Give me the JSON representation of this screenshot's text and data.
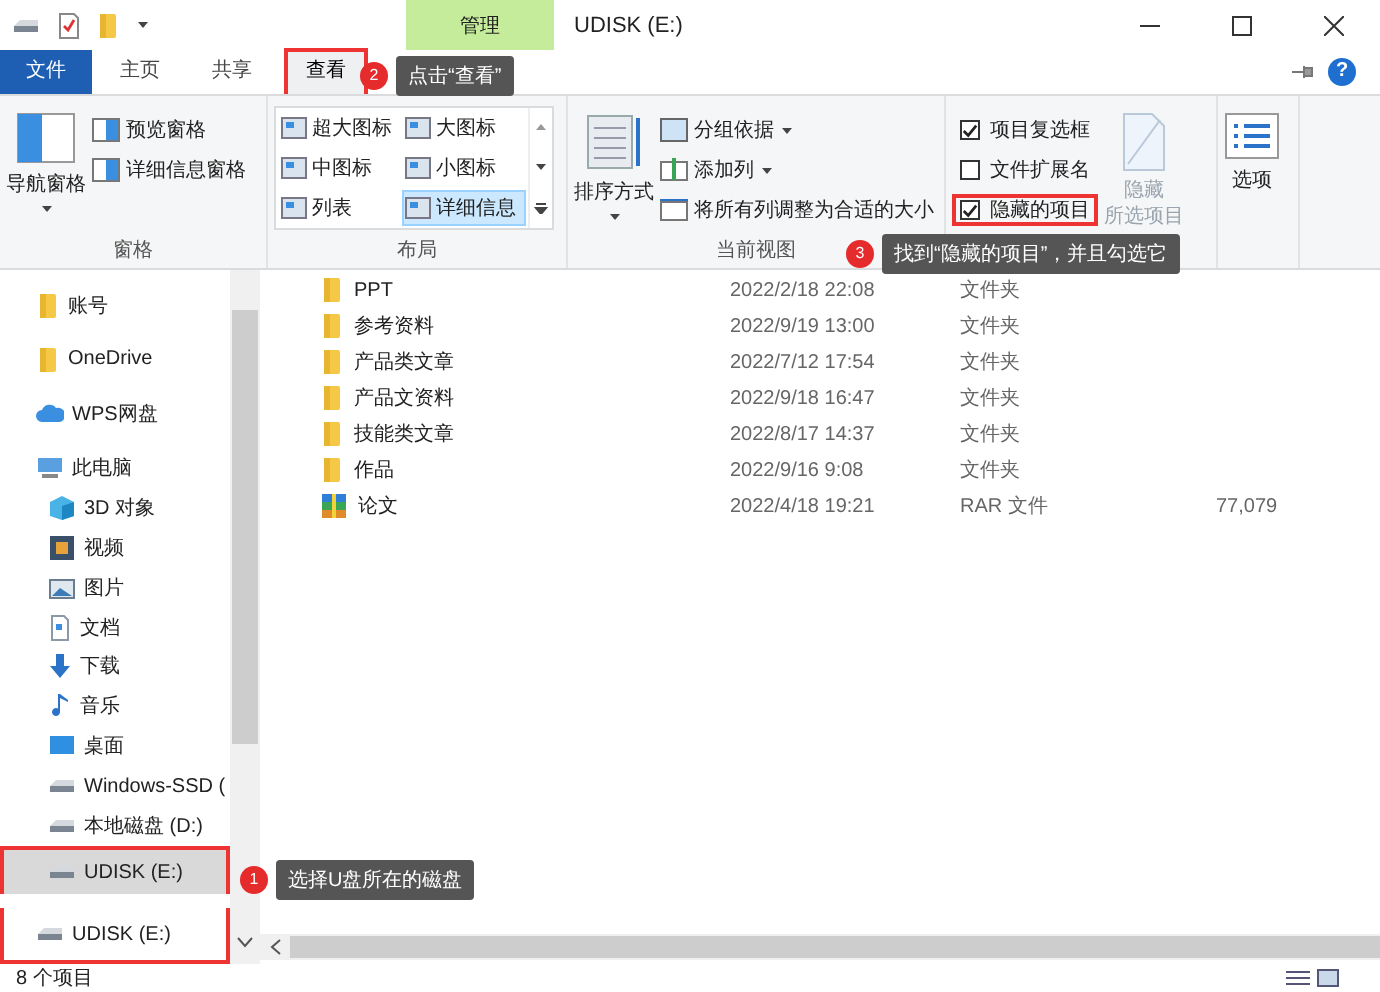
{
  "title_bar": {
    "context_tab": "管理",
    "title": "UDISK (E:)"
  },
  "ribbon_tabs": [
    {
      "label": "文件",
      "kind": "file",
      "selected": false,
      "highlighted": false
    },
    {
      "label": "主页",
      "kind": "tab",
      "selected": false,
      "highlighted": false
    },
    {
      "label": "共享",
      "kind": "tab",
      "selected": false,
      "highlighted": false
    },
    {
      "label": "查看",
      "kind": "tab",
      "selected": true,
      "highlighted": true
    }
  ],
  "help": "?",
  "ribbon": {
    "panes": {
      "label": "窗格",
      "large": "导航窗格",
      "items": [
        "预览窗格",
        "详细信息窗格"
      ]
    },
    "layout": {
      "label": "布局",
      "items": [
        {
          "label": "超大图标",
          "selected": false
        },
        {
          "label": "大图标",
          "selected": false
        },
        {
          "label": "中图标",
          "selected": false
        },
        {
          "label": "小图标",
          "selected": false
        },
        {
          "label": "列表",
          "selected": false
        },
        {
          "label": "详细信息",
          "selected": true
        }
      ]
    },
    "current_view": {
      "label": "当前视图",
      "large": "排序方式",
      "items": [
        {
          "label": "分组依据",
          "dropdown": true
        },
        {
          "label": "添加列",
          "dropdown": true
        },
        {
          "label": "将所有列调整为合适的大小",
          "dropdown": false
        }
      ]
    },
    "show_hide": {
      "checkboxes": [
        {
          "label": "项目复选框",
          "checked": true,
          "highlighted": false
        },
        {
          "label": "文件扩展名",
          "checked": false,
          "highlighted": false
        },
        {
          "label": "隐藏的项目",
          "checked": true,
          "highlighted": true
        }
      ],
      "button": {
        "lines": [
          "隐藏",
          "所选项目"
        ],
        "disabled": true
      }
    },
    "options": {
      "label": "选项"
    }
  },
  "nav": [
    {
      "label": "账号",
      "kind": "folder",
      "selected": false,
      "highlighted": false
    },
    {
      "label": "OneDrive",
      "kind": "folder",
      "selected": false,
      "highlighted": false
    },
    {
      "label": "WPS网盘",
      "kind": "cloud",
      "selected": false,
      "highlighted": false
    },
    {
      "label": "此电脑",
      "kind": "pc",
      "selected": false,
      "highlighted": false,
      "children": [
        {
          "label": "3D 对象",
          "kind": "cube",
          "selected": false,
          "highlighted": false
        },
        {
          "label": "视频",
          "kind": "video",
          "selected": false,
          "highlighted": false
        },
        {
          "label": "图片",
          "kind": "picture",
          "selected": false,
          "highlighted": false
        },
        {
          "label": "文档",
          "kind": "document",
          "selected": false,
          "highlighted": false
        },
        {
          "label": "下载",
          "kind": "download",
          "selected": false,
          "highlighted": false
        },
        {
          "label": "音乐",
          "kind": "music",
          "selected": false,
          "highlighted": false
        },
        {
          "label": "桌面",
          "kind": "desktop",
          "selected": false,
          "highlighted": false
        },
        {
          "label": "Windows-SSD (",
          "kind": "drive",
          "selected": false,
          "highlighted": false
        },
        {
          "label": "本地磁盘 (D:)",
          "kind": "drive",
          "selected": false,
          "highlighted": false
        },
        {
          "label": "UDISK (E:)",
          "kind": "drive",
          "selected": true,
          "highlighted": true
        }
      ]
    },
    {
      "label": "UDISK (E:)",
      "kind": "drive",
      "selected": false,
      "highlighted": true
    }
  ],
  "files": [
    {
      "name": "PPT",
      "kind": "folder",
      "date": "2022/2/18 22:08",
      "type": "文件夹"
    },
    {
      "name": "参考资料",
      "kind": "folder",
      "date": "2022/9/19 13:00",
      "type": "文件夹"
    },
    {
      "name": "产品类文章",
      "kind": "folder",
      "date": "2022/7/12 17:54",
      "type": "文件夹"
    },
    {
      "name": "产品文资料",
      "kind": "folder",
      "date": "2022/9/18 16:47",
      "type": "文件夹"
    },
    {
      "name": "技能类文章",
      "kind": "folder",
      "date": "2022/8/17 14:37",
      "type": "文件夹"
    },
    {
      "name": "作品",
      "kind": "folder",
      "date": "2022/9/16 9:08",
      "type": "文件夹"
    },
    {
      "name": "论文",
      "kind": "archive",
      "date": "2022/4/18 19:21",
      "type": "RAR 文件",
      "size": "77,079"
    }
  ],
  "status_bar": {
    "count": "8 个项目"
  },
  "callouts": [
    {
      "number": "2",
      "text": "点击“查看”"
    },
    {
      "number": "3",
      "text": "找到“隐藏的项目”，并且勾选它"
    },
    {
      "number": "1",
      "text": "选择U盘所在的磁盘"
    }
  ]
}
